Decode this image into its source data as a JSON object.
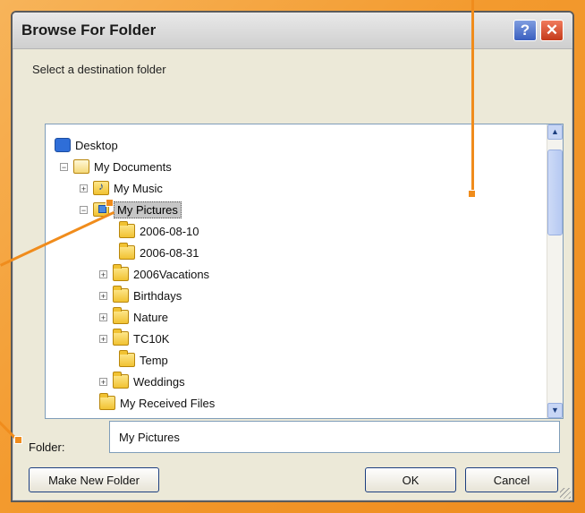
{
  "window": {
    "title": "Browse For Folder",
    "help_symbol": "?",
    "close_symbol": "✕"
  },
  "instruction": "Select a destination folder",
  "tree": {
    "items": [
      {
        "label": "Desktop",
        "icon": "desktop-icon",
        "expander": ""
      },
      {
        "label": "My Documents",
        "icon": "documents-icon",
        "expander": "−"
      },
      {
        "label": "My Music",
        "icon": "music-folder-icon",
        "expander": "+"
      },
      {
        "label": "My Pictures",
        "icon": "pictures-folder-icon",
        "expander": "−",
        "selected": true
      },
      {
        "label": "2006-08-10",
        "icon": "folder-icon",
        "expander": ""
      },
      {
        "label": "2006-08-31",
        "icon": "folder-icon",
        "expander": ""
      },
      {
        "label": "2006Vacations",
        "icon": "folder-icon",
        "expander": "+"
      },
      {
        "label": "Birthdays",
        "icon": "folder-icon",
        "expander": "+"
      },
      {
        "label": "Nature",
        "icon": "folder-icon",
        "expander": "+"
      },
      {
        "label": "TC10K",
        "icon": "folder-icon",
        "expander": "+"
      },
      {
        "label": "Temp",
        "icon": "folder-icon",
        "expander": ""
      },
      {
        "label": "Weddings",
        "icon": "folder-icon",
        "expander": "+"
      },
      {
        "label": "My Received Files",
        "icon": "folder-icon",
        "expander": ""
      }
    ]
  },
  "folder_field": {
    "label": "Folder:",
    "value": "My Pictures"
  },
  "buttons": {
    "make_new_folder": "Make New Folder",
    "ok": "OK",
    "cancel": "Cancel"
  },
  "colors": {
    "background": "#f39a2e",
    "callout": "#f08c1c",
    "selection": "#c6c6c6"
  }
}
